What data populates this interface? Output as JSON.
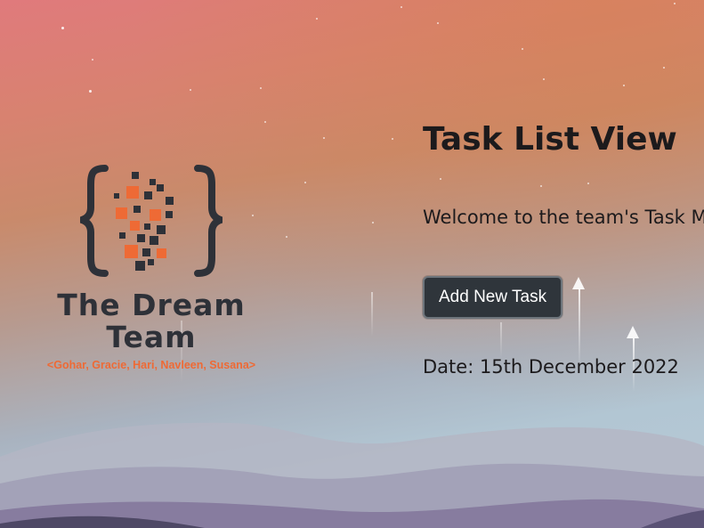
{
  "logo": {
    "name": "The Dream Team",
    "members": "<Gohar, Gracie, Hari, Navleen, Susana>"
  },
  "main": {
    "title": "Task List View",
    "welcome": "Welcome to the team's Task M",
    "add_button_label": "Add New Task",
    "date": "Date: 15th December 2022"
  },
  "colors": {
    "accent": "#ee6a35",
    "dark": "#2e3138",
    "button_bg": "#2f353b"
  }
}
